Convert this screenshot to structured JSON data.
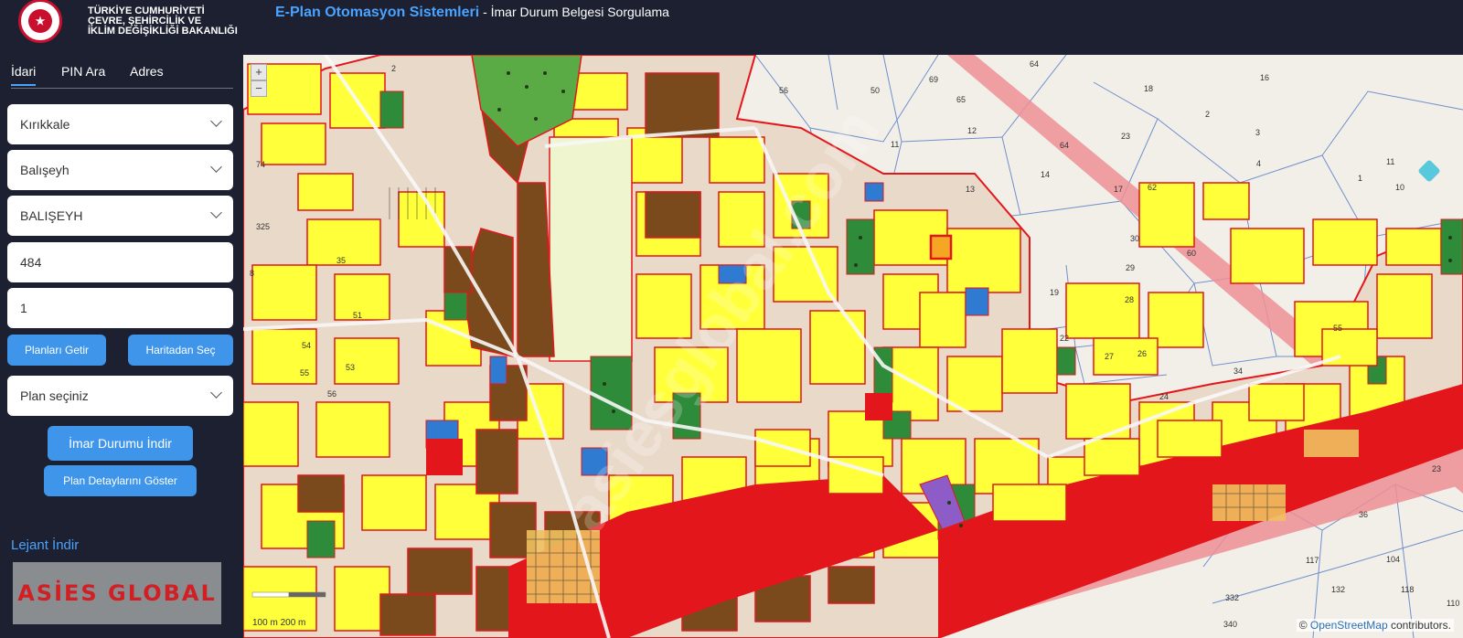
{
  "header": {
    "ministry_lines": [
      "TÜRKİYE CUMHURİYETİ",
      "ÇEVRE, ŞEHİRCİLİK VE",
      "İKLİM DEĞİŞİKLİĞİ BAKANLIĞI"
    ],
    "app_title": "E-Plan Otomasyon Sistemleri",
    "app_subtitle": " - İmar Durum Belgesi Sorgulama"
  },
  "sidebar": {
    "tabs": [
      {
        "label": "İdari",
        "active": true
      },
      {
        "label": "PIN Ara",
        "active": false
      },
      {
        "label": "Adres",
        "active": false
      }
    ],
    "province": "Kırıkkale",
    "district": "Balışeyh",
    "neighborhood": "BALIŞEYH",
    "block": "484",
    "parcel": "1",
    "btn_get_plans": "Planları Getir",
    "btn_select_map": "Haritadan Seç",
    "plan_select": "Plan seçiniz",
    "btn_download": "İmar Durumu İndir",
    "btn_details": "Plan Detaylarını Göster",
    "legend_link": "Lejant İndir",
    "brand_text": "ASİES GLOBAL"
  },
  "map": {
    "zoom_in": "+",
    "zoom_out": "−",
    "scale_text": "100 m   200 m",
    "attribution_prefix": "© ",
    "attribution_link": "OpenStreetMap",
    "attribution_suffix": " contributors.",
    "watermark": "asiesglobal.com",
    "parcel_numbers": [
      "2",
      "64",
      "56",
      "50",
      "69",
      "65",
      "18",
      "16",
      "74",
      "11",
      "12",
      "64",
      "23",
      "3",
      "2",
      "11",
      "1",
      "14",
      "13",
      "17",
      "62",
      "4",
      "10",
      "325",
      "30",
      "60",
      "35",
      "29",
      "19",
      "28",
      "8",
      "51",
      "55",
      "54",
      "22",
      "27",
      "26",
      "34",
      "53",
      "55",
      "24",
      "56",
      "23",
      "36",
      "104",
      "117",
      "132",
      "118",
      "110",
      "332",
      "340"
    ],
    "colors": {
      "residential": "#ffff3a",
      "commercial": "#7b4a1c",
      "green": "#2e8b3a",
      "industrial": "#e3161c",
      "road": "#ee8f95",
      "parcel_line": "#6f8fcc",
      "background": "#f2efe8"
    }
  }
}
